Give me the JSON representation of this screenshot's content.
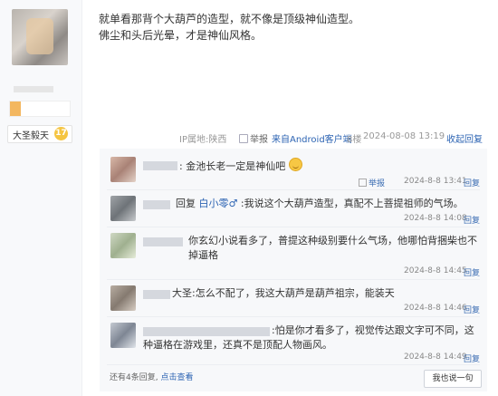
{
  "post": {
    "text_line1": "就单看那背个大葫芦的造型，就不像是顶级神仙造型。",
    "text_line2": "佛尘和头后光晕，才是神仙风格。",
    "rank": "大圣毅天",
    "level": "17",
    "ip_location": "IP属地:陕西",
    "report_label": "举报",
    "client": "来自Android客户端",
    "floor": "8楼",
    "timestamp": "2024-08-08 13:19",
    "collapse_label": "收起回复"
  },
  "comments": [
    {
      "text": ": 金池长老一定是神仙吧",
      "time": "2024-8-8 13:41",
      "report": "回复",
      "report_label": "举报",
      "has_emoji": true
    },
    {
      "reply_prefix": "回复",
      "reply_name": "白小零♂",
      "text": ":我说这个大葫芦造型，真配不上菩提祖师的气场。",
      "time": "2024-8-8 14:08",
      "report": "回复"
    },
    {
      "text": "你玄幻小说看多了，普提这种级别要什么气场，他哪怕背捆柴也不掉逼格",
      "time": "2024-8-8 14:45",
      "report": "回复"
    },
    {
      "text": "大圣:怎么不配了，我这大葫芦是葫芦祖宗，能装天",
      "time": "2024-8-8 14:46",
      "report": "回复"
    },
    {
      "text": ":怕是你才看多了，视觉传达跟文字可不同，这种逼格在游戏里，还真不是顶配人物画风。",
      "time": "2024-8-8 14:49",
      "report": "回复"
    }
  ],
  "footer": {
    "more_text": "还有4条回复,",
    "more_link": "点击查看",
    "say_button": "我也说一句"
  }
}
